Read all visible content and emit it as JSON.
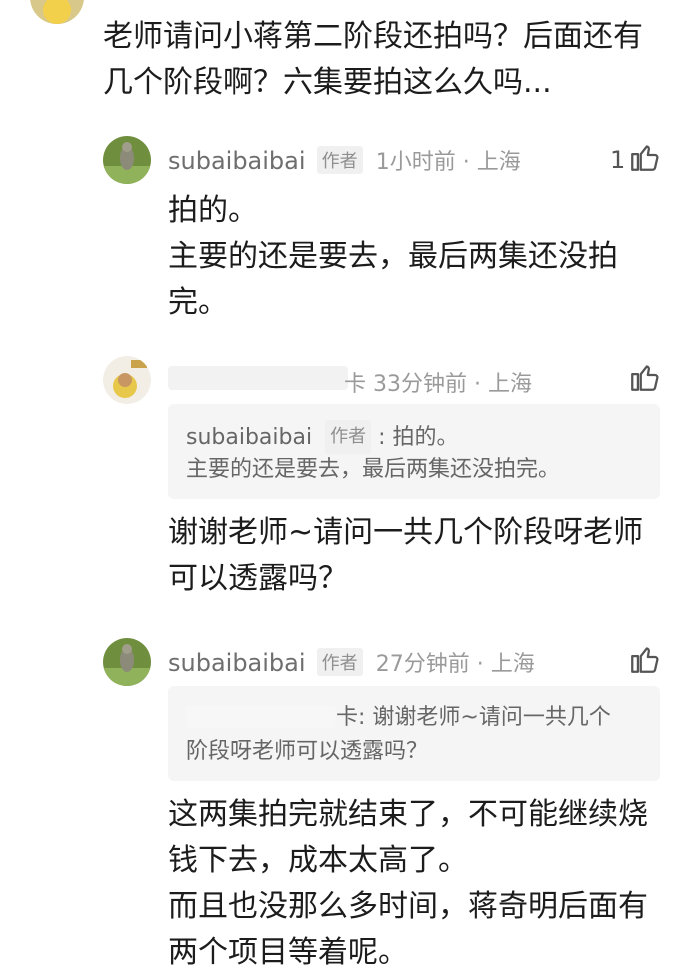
{
  "top_comment": {
    "text": "老师请问小蒋第二阶段还拍吗？后面还有\n几个阶段啊？六集要拍这么久吗..."
  },
  "reply1": {
    "user": "subaibaibai",
    "badge": "作者",
    "meta": "1小时前 · 上海",
    "like_count": "1",
    "text": "拍的。\n主要的还是要去，最后两集还没拍\n完。"
  },
  "reply2": {
    "meta": "卡 33分钟前 · 上海",
    "quote_user": "subaibaibai",
    "quote_badge": "作者",
    "quote_text1": ": 拍的。",
    "quote_text2": "主要的还是要去，最后两集还没拍完。",
    "text": "谢谢老师~请问一共几个阶段呀老师\n可以透露吗？"
  },
  "reply3": {
    "user": "subaibaibai",
    "badge": "作者",
    "meta": "27分钟前 · 上海",
    "quote_line1": "卡: 谢谢老师~请问一共几个",
    "quote_line2": "阶段呀老师可以透露吗？",
    "text": "这两集拍完就结束了，不可能继续烧\n钱下去，成本太高了。\n而且也没那么多时间，蒋奇明后面有\n两个项目等着呢。"
  },
  "icons": {
    "like": "thumbs-up-icon"
  }
}
